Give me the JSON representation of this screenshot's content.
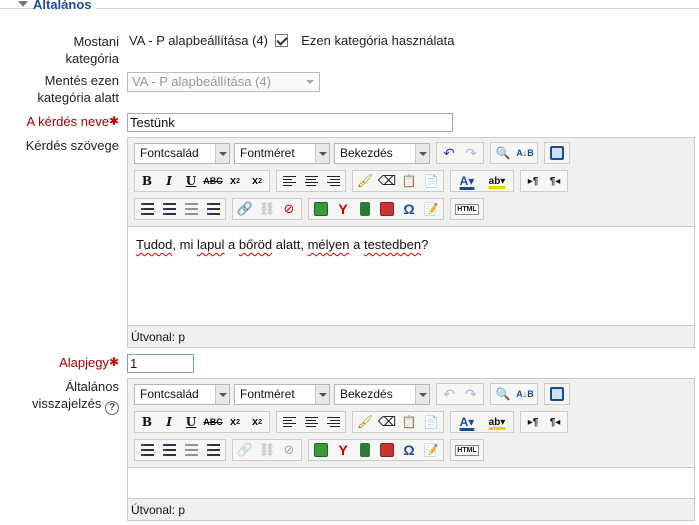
{
  "section": {
    "title": "Általános"
  },
  "current_category": {
    "label_line1": "Mostani",
    "label_line2": "kategória",
    "value": "VA - P alapbeállítása (4)",
    "checkbox_label": "Ezen kategória használata",
    "checked": true
  },
  "save_category": {
    "label_line1": "Mentés ezen",
    "label_line2": "kategória alatt",
    "selected": "VA - P alapbeállítása (4)"
  },
  "question_name": {
    "label": "A kérdés neve",
    "value": "Testünk"
  },
  "question_text": {
    "label": "Kérdés szövege",
    "toolbar": {
      "font_family": "Fontcsalád",
      "font_size": "Fontméret",
      "format": "Bekezdés",
      "html_button": "HTML"
    },
    "content": "Tudod, mi lapul a bőröd alatt, mélyen a testedben?",
    "path": "Útvonal: p"
  },
  "default_grade": {
    "label": "Alapjegy",
    "value": "1"
  },
  "general_feedback": {
    "label_line1": "Általános",
    "label_line2": "visszajelzés",
    "toolbar": {
      "font_family": "Fontcsalád",
      "font_size": "Fontméret",
      "format": "Bekezdés",
      "html_button": "HTML"
    },
    "path": "Útvonal: p"
  },
  "colors": {
    "accent": "#1a4b9b",
    "required": "#aa0000"
  }
}
